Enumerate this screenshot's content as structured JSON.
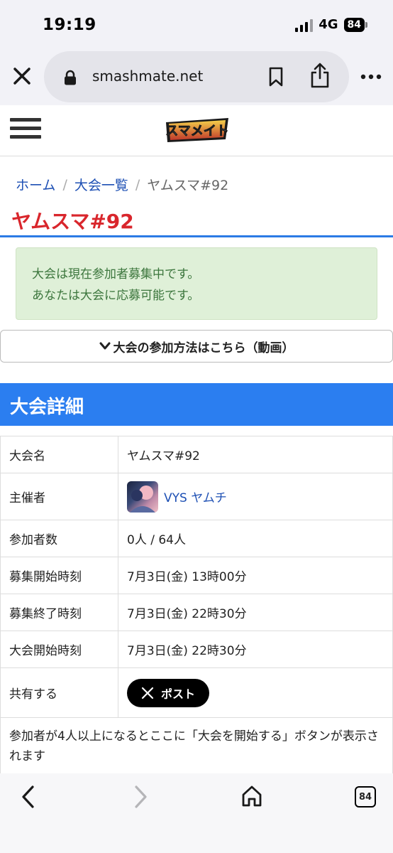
{
  "status_bar": {
    "time": "19:19",
    "network": "4G",
    "battery": "84"
  },
  "browser": {
    "url": "smashmate.net",
    "tab_count": "84"
  },
  "site": {
    "logo_text": "スマメイト"
  },
  "breadcrumb": {
    "home": "ホーム",
    "separator": "/",
    "list": "大会一覧",
    "current": "ヤムスマ#92"
  },
  "page_title": "ヤムスマ#92",
  "alert": {
    "line1": "大会は現在参加者募集中です。",
    "line2": "あなたは大会に応募可能です。"
  },
  "howto_button": "大会の参加方法はこちら（動画）",
  "section_title": "大会詳細",
  "details": {
    "name_label": "大会名",
    "name_value": "ヤムスマ#92",
    "organizer_label": "主催者",
    "organizer_value": "VYS ヤムチ",
    "participants_label": "参加者数",
    "participants_value": "0人 / 64人",
    "recruit_start_label": "募集開始時刻",
    "recruit_start_value": "7月3日(金) 13時00分",
    "recruit_end_label": "募集終了時刻",
    "recruit_end_value": "7月3日(金) 22時30分",
    "start_label": "大会開始時刻",
    "start_value": "7月3日(金) 22時30分",
    "share_label": "共有する",
    "share_button": "ポスト",
    "note": "参加者が4人以上になるとここに「大会を開始する」ボタンが表示されます"
  },
  "colors": {
    "accent_blue": "#2b7ef0",
    "title_red": "#d9262c",
    "link_blue": "#1e50b4",
    "alert_green_bg": "#dff0d8",
    "alert_green_text": "#3c763d"
  }
}
